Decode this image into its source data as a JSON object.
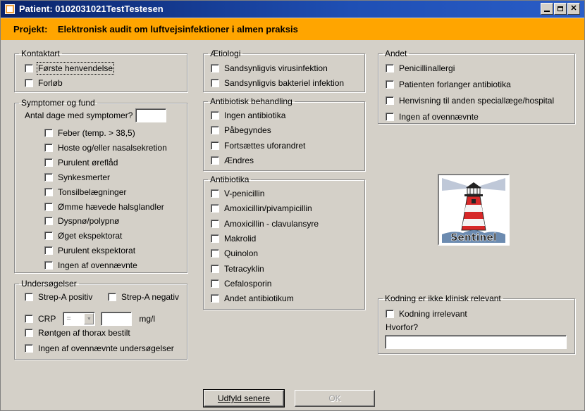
{
  "window": {
    "title": "Patient: 0102031021TestTestesen"
  },
  "project": {
    "label": "Projekt:    Elektronisk audit om luftvejsinfektioner i almen praksis"
  },
  "kontaktart": {
    "title": "Kontaktart",
    "items": [
      "Første henvendelse",
      "Forløb"
    ]
  },
  "symptomer": {
    "title": "Symptomer og fund",
    "days_label": "Antal dage med symptomer?",
    "days_value": "",
    "items": [
      "Feber (temp. > 38,5)",
      "Hoste og/eller nasalsekretion",
      "Purulent øreflåd",
      "Synkesmerter",
      "Tonsilbelægninger",
      "Ømme hævede halsglandler",
      "Dyspnø/polypnø",
      "Øget ekspektorat",
      "Purulent ekspektorat",
      "Ingen af ovennævnte"
    ]
  },
  "undersoegelser": {
    "title": "Undersøgelser",
    "strep_pos": "Strep-A positiv",
    "strep_neg": "Strep-A negativ",
    "crp": "CRP",
    "crp_operator": "=",
    "crp_value": "",
    "crp_unit": "mg/l",
    "roentgen": "Røntgen af thorax bestilt",
    "ingen": "Ingen af ovennævnte undersøgelser"
  },
  "aetiologi": {
    "title": "Ætiologi",
    "items": [
      "Sandsynligvis virusinfektion",
      "Sandsynligvis bakteriel infektion"
    ]
  },
  "behandling": {
    "title": "Antibiotisk behandling",
    "items": [
      "Ingen antibiotika",
      "Påbegyndes",
      "Fortsættes uforandret",
      "Ændres"
    ]
  },
  "antibiotika": {
    "title": "Antibiotika",
    "items": [
      "V-penicillin",
      "Amoxicillin/pivampicillin",
      "Amoxicillin - clavulansyre",
      "Makrolid",
      "Quinolon",
      "Tetracyklin",
      "Cefalosporin",
      "Andet antibiotikum"
    ]
  },
  "andet": {
    "title": "Andet",
    "items": [
      "Penicillinallergi",
      "Patienten forlanger antibiotika",
      "Henvisning til anden speciallæge/hospital",
      "Ingen af ovennævnte"
    ]
  },
  "logo": {
    "text": "Sentinel"
  },
  "kodning": {
    "title": "Kodning er ikke klinisk relevant",
    "checkbox": "Kodning irrelevant",
    "hvorfor_label": "Hvorfor?",
    "hvorfor_value": ""
  },
  "buttons": {
    "fill_later": "Udfyld senere",
    "ok": "OK"
  }
}
